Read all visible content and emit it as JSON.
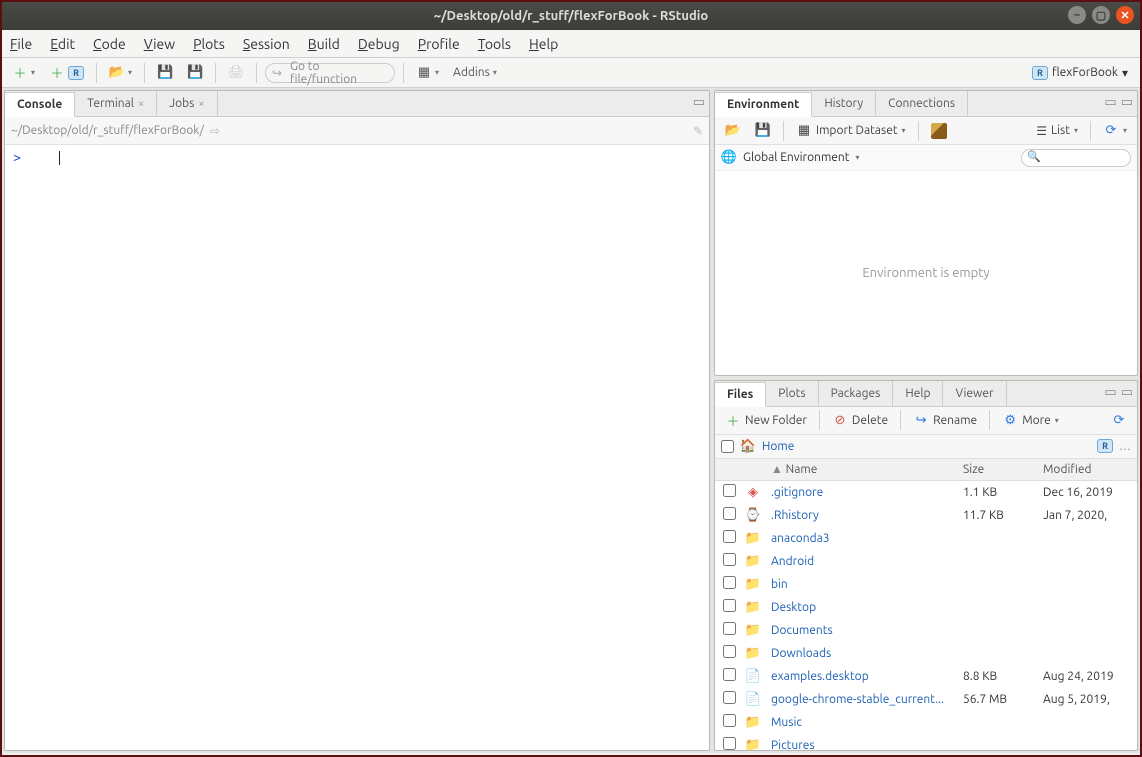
{
  "window": {
    "title": "~/Desktop/old/r_stuff/flexForBook - RStudio"
  },
  "menubar": [
    "File",
    "Edit",
    "Code",
    "View",
    "Plots",
    "Session",
    "Build",
    "Debug",
    "Profile",
    "Tools",
    "Help"
  ],
  "toolbar": {
    "goto_placeholder": "Go to file/function",
    "addins": "Addins",
    "project": "flexForBook"
  },
  "left": {
    "tabs": [
      "Console",
      "Terminal",
      "Jobs"
    ],
    "active": 0,
    "path": "~/Desktop/old/r_stuff/flexForBook/",
    "prompt": ">"
  },
  "env": {
    "tabs": [
      "Environment",
      "History",
      "Connections"
    ],
    "active": 0,
    "import_label": "Import Dataset",
    "list_label": "List",
    "scope": "Global Environment",
    "empty_msg": "Environment is empty"
  },
  "files": {
    "tabs": [
      "Files",
      "Plots",
      "Packages",
      "Help",
      "Viewer"
    ],
    "active": 0,
    "new_folder": "New Folder",
    "delete": "Delete",
    "rename": "Rename",
    "more": "More",
    "breadcrumb": "Home",
    "columns": {
      "name": "Name",
      "size": "Size",
      "modified": "Modified"
    },
    "rows": [
      {
        "icon": "git",
        "name": ".gitignore",
        "size": "1.1 KB",
        "modified": "Dec 16, 2019"
      },
      {
        "icon": "rfile",
        "name": ".Rhistory",
        "size": "11.7 KB",
        "modified": "Jan 7, 2020,"
      },
      {
        "icon": "folder",
        "name": "anaconda3",
        "size": "",
        "modified": ""
      },
      {
        "icon": "folder",
        "name": "Android",
        "size": "",
        "modified": ""
      },
      {
        "icon": "folder",
        "name": "bin",
        "size": "",
        "modified": ""
      },
      {
        "icon": "folder",
        "name": "Desktop",
        "size": "",
        "modified": ""
      },
      {
        "icon": "folder",
        "name": "Documents",
        "size": "",
        "modified": ""
      },
      {
        "icon": "folder",
        "name": "Downloads",
        "size": "",
        "modified": ""
      },
      {
        "icon": "file",
        "name": "examples.desktop",
        "size": "8.8 KB",
        "modified": "Aug 24, 2019"
      },
      {
        "icon": "file",
        "name": "google-chrome-stable_current...",
        "size": "56.7 MB",
        "modified": "Aug 5, 2019,"
      },
      {
        "icon": "folder",
        "name": "Music",
        "size": "",
        "modified": ""
      },
      {
        "icon": "folder",
        "name": "Pictures",
        "size": "",
        "modified": ""
      }
    ]
  }
}
